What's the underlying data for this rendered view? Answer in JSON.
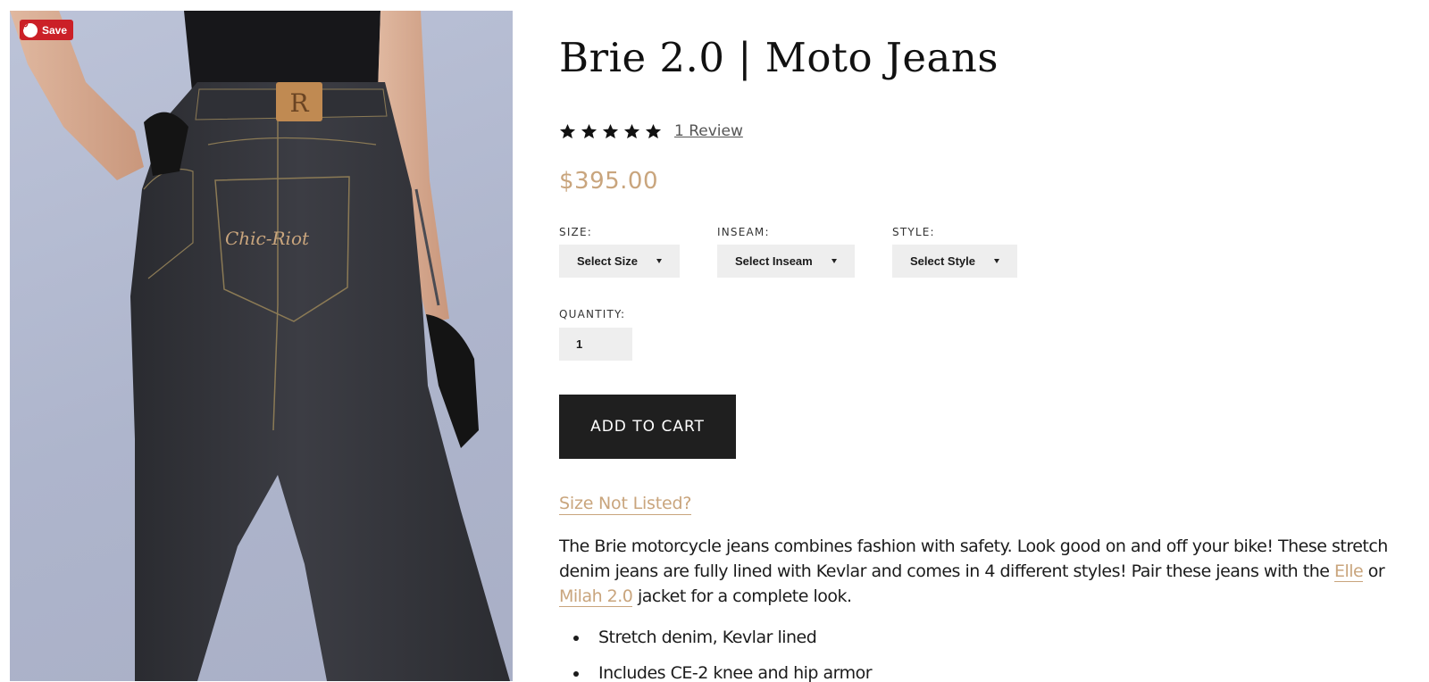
{
  "image": {
    "alt": "",
    "pin_button": {
      "label": "Save",
      "icon": "pinterest-icon",
      "color": "#cb2027"
    },
    "patch_letter": "R",
    "embroidery": "Chic-Riot"
  },
  "product": {
    "title": "Brie 2.0 | Moto Jeans",
    "rating": {
      "stars": 5,
      "max": 5,
      "review_label": "1 Review"
    },
    "price": "$395.00",
    "accent_color": "#c9a57d"
  },
  "options": [
    {
      "label": "SIZE:",
      "selected": "Select Size"
    },
    {
      "label": "INSEAM:",
      "selected": "Select Inseam"
    },
    {
      "label": "STYLE:",
      "selected": "Select Style"
    }
  ],
  "quantity": {
    "label": "QUANTITY:",
    "value": "1"
  },
  "add_to_cart_label": "ADD TO CART",
  "size_not_listed": "Size Not Listed?",
  "description": {
    "text_1": "The Brie motorcycle jeans combines fashion with safety. Look good on and off your bike! These stretch denim jeans are fully lined with Kevlar and comes in 4 different styles! Pair these jeans with the ",
    "link_1": "Elle",
    "text_2": " or ",
    "link_2": "Milah 2.0",
    "text_3": " jacket for a complete look."
  },
  "features": [
    "Stretch denim, Kevlar lined",
    "Includes CE-2 knee and hip armor"
  ]
}
